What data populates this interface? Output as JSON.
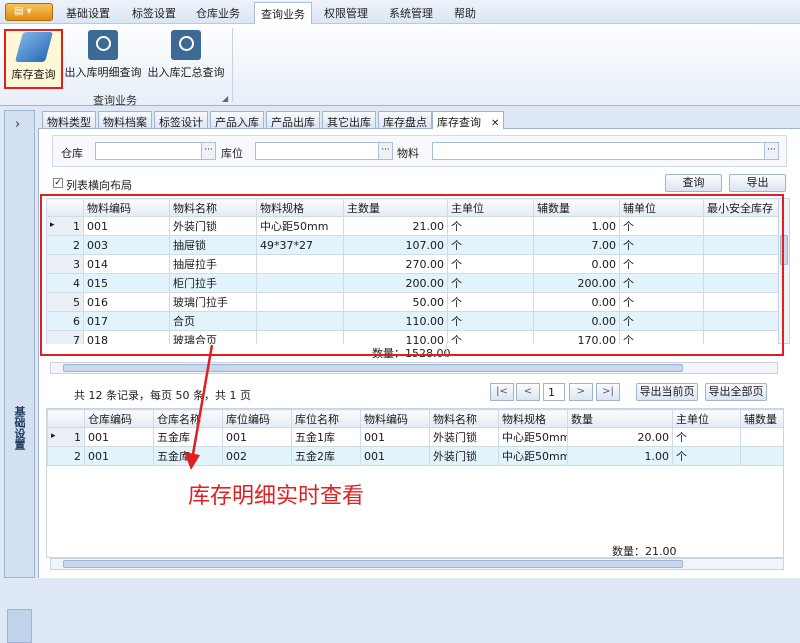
{
  "menubar": {
    "app_label": "▤ ▾",
    "items": [
      "基础设置",
      "标签设置",
      "仓库业务",
      "查询业务",
      "权限管理",
      "系统管理",
      "帮助"
    ]
  },
  "ribbon": {
    "buttons": [
      "库存查询",
      "出入库明细查询",
      "出入库汇总查询"
    ],
    "group_label": "查询业务",
    "group_expand": "◢"
  },
  "nav": {
    "label": "基础设置",
    "chevron": "›"
  },
  "tabs": [
    "物料类型",
    "物料档案",
    "标签设计",
    "产品入库",
    "产品出库",
    "其它出库",
    "库存盘点",
    "库存查询"
  ],
  "tab_close": "✕",
  "filter": {
    "warehouse_label": "仓库",
    "location_label": "库位",
    "material_label": "物料",
    "warehouse_value": "",
    "location_value": "",
    "material_value": "",
    "dots": "···",
    "horizontal_layout_label": "列表横向布局",
    "checked_mark": "✓",
    "query_button": "查询",
    "export_button": "导出"
  },
  "top_grid": {
    "columns": [
      "物料编码",
      "物料名称",
      "物料规格",
      "主数量",
      "主单位",
      "辅数量",
      "辅单位",
      "最小安全库存"
    ],
    "rows": [
      {
        "rn": "1",
        "code": "001",
        "name": "外装门锁",
        "spec": "中心距50mm",
        "qty": "21.00",
        "unit": "个",
        "aux_qty": "1.00",
        "aux_unit": "个"
      },
      {
        "rn": "2",
        "code": "003",
        "name": "抽屉锁",
        "spec": "49*37*27",
        "qty": "107.00",
        "unit": "个",
        "aux_qty": "7.00",
        "aux_unit": "个"
      },
      {
        "rn": "3",
        "code": "014",
        "name": "抽屉拉手",
        "spec": "",
        "qty": "270.00",
        "unit": "个",
        "aux_qty": "0.00",
        "aux_unit": "个"
      },
      {
        "rn": "4",
        "code": "015",
        "name": "柜门拉手",
        "spec": "",
        "qty": "200.00",
        "unit": "个",
        "aux_qty": "200.00",
        "aux_unit": "个"
      },
      {
        "rn": "5",
        "code": "016",
        "name": "玻璃门拉手",
        "spec": "",
        "qty": "50.00",
        "unit": "个",
        "aux_qty": "0.00",
        "aux_unit": "个"
      },
      {
        "rn": "6",
        "code": "017",
        "name": "合页",
        "spec": "",
        "qty": "110.00",
        "unit": "个",
        "aux_qty": "0.00",
        "aux_unit": "个"
      },
      {
        "rn": "7",
        "code": "018",
        "name": "玻璃合页",
        "spec": "",
        "qty": "110.00",
        "unit": "个",
        "aux_qty": "170.00",
        "aux_unit": "个"
      }
    ],
    "current_row_marker": "▸",
    "summary": "数量：1528.00"
  },
  "pager": {
    "info": "共 12 条记录，每页 50 条，共 1 页",
    "first": "|<",
    "prev": "<",
    "page": "1",
    "next": ">",
    "last": ">|",
    "export_page": "导出当前页",
    "export_all": "导出全部页"
  },
  "bottom_grid": {
    "columns": [
      "仓库编码",
      "仓库名称",
      "库位编码",
      "库位名称",
      "物料编码",
      "物料名称",
      "物料规格",
      "数量",
      "主单位",
      "辅数量"
    ],
    "rows": [
      {
        "rn": "1",
        "wh_code": "001",
        "wh_name": "五金库",
        "loc_code": "001",
        "loc_name": "五金1库",
        "mat_code": "001",
        "mat_name": "外装门锁",
        "spec": "中心距50mm",
        "qty": "20.00",
        "unit": "个"
      },
      {
        "rn": "2",
        "wh_code": "001",
        "wh_name": "五金库",
        "loc_code": "002",
        "loc_name": "五金2库",
        "mat_code": "001",
        "mat_name": "外装门锁",
        "spec": "中心距50mm",
        "qty": "1.00",
        "unit": "个"
      }
    ],
    "summary": "数量：21.00"
  },
  "callout": "库存明细实时查看",
  "colors": {
    "highlight_red": "#e02020",
    "row_alt": "#e2f3fb"
  }
}
